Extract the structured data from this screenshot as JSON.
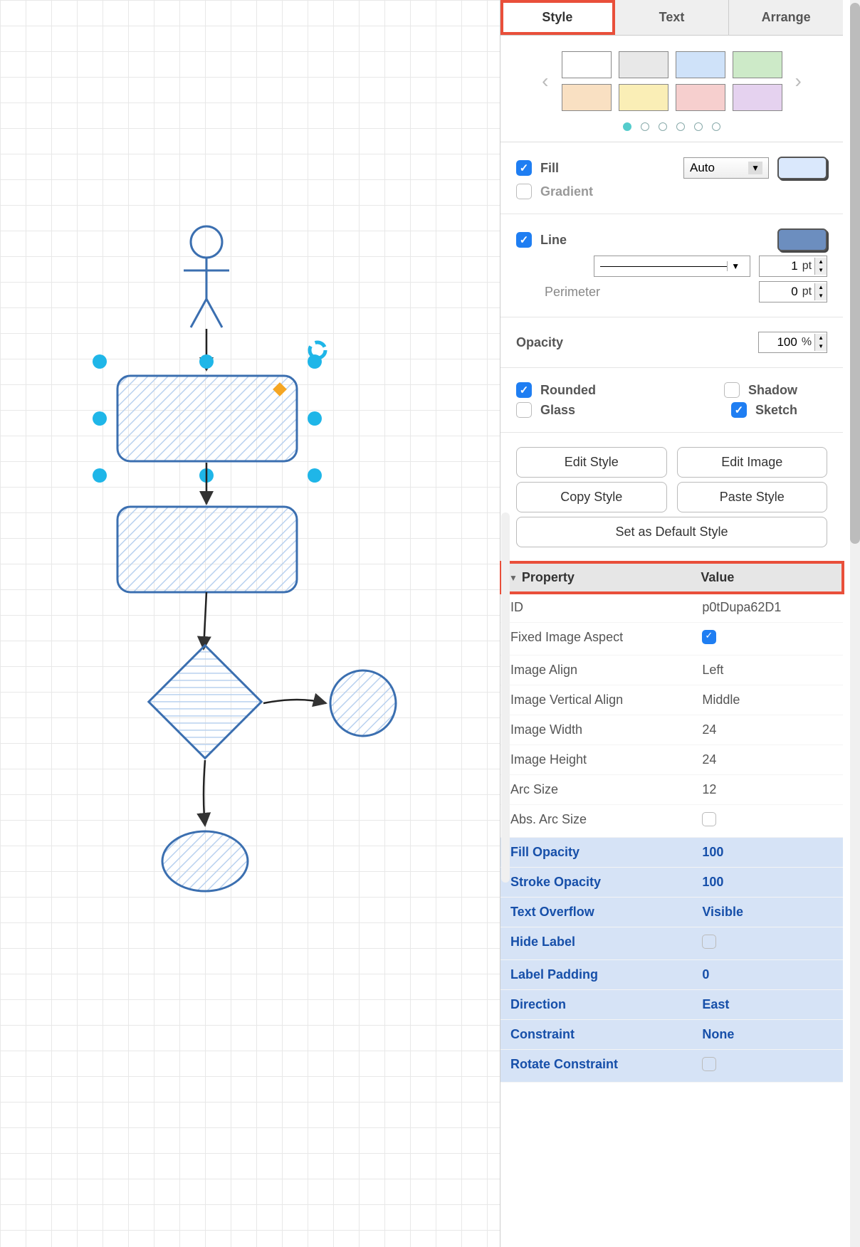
{
  "tabs": {
    "style": "Style",
    "text": "Text",
    "arrange": "Arrange"
  },
  "palette": {
    "colors_row1": [
      "#ffffff",
      "#e8e8e8",
      "#cfe2f9",
      "#cdeac8"
    ],
    "colors_row2": [
      "#f9e0c2",
      "#faeeb6",
      "#f6cfce",
      "#e5d2ef"
    ]
  },
  "fill": {
    "label": "Fill",
    "checked": true,
    "mode": "Auto",
    "color": "#dae8fc"
  },
  "gradient": {
    "label": "Gradient",
    "checked": false
  },
  "line": {
    "label": "Line",
    "checked": true,
    "color": "#6c8ebf",
    "width_value": "1",
    "width_unit": "pt"
  },
  "perimeter": {
    "label": "Perimeter",
    "value": "0",
    "unit": "pt"
  },
  "opacity": {
    "label": "Opacity",
    "value": "100",
    "unit": "%"
  },
  "toggles": {
    "rounded": {
      "label": "Rounded",
      "checked": true
    },
    "shadow": {
      "label": "Shadow",
      "checked": false
    },
    "glass": {
      "label": "Glass",
      "checked": false
    },
    "sketch": {
      "label": "Sketch",
      "checked": true
    }
  },
  "buttons": {
    "edit_style": "Edit Style",
    "edit_image": "Edit Image",
    "copy_style": "Copy Style",
    "paste_style": "Paste Style",
    "set_default": "Set as Default Style"
  },
  "prop_header": {
    "property": "Property",
    "value": "Value"
  },
  "properties": [
    {
      "k": "ID",
      "v": "p0tDupa62D1",
      "hl": false,
      "chk": null
    },
    {
      "k": "Fixed Image Aspect",
      "v": "",
      "hl": false,
      "chk": true
    },
    {
      "k": "Image Align",
      "v": "Left",
      "hl": false,
      "chk": null
    },
    {
      "k": "Image Vertical Align",
      "v": "Middle",
      "hl": false,
      "chk": null
    },
    {
      "k": "Image Width",
      "v": "24",
      "hl": false,
      "chk": null
    },
    {
      "k": "Image Height",
      "v": "24",
      "hl": false,
      "chk": null
    },
    {
      "k": "Arc Size",
      "v": "12",
      "hl": false,
      "chk": null
    },
    {
      "k": "Abs. Arc Size",
      "v": "",
      "hl": false,
      "chk": false
    },
    {
      "k": "Fill Opacity",
      "v": "100",
      "hl": true,
      "chk": null
    },
    {
      "k": "Stroke Opacity",
      "v": "100",
      "hl": true,
      "chk": null
    },
    {
      "k": "Text Overflow",
      "v": "Visible",
      "hl": true,
      "chk": null
    },
    {
      "k": "Hide Label",
      "v": "",
      "hl": true,
      "chk": false
    },
    {
      "k": "Label Padding",
      "v": "0",
      "hl": true,
      "chk": null
    },
    {
      "k": "Direction",
      "v": "East",
      "hl": true,
      "chk": null
    },
    {
      "k": "Constraint",
      "v": "None",
      "hl": true,
      "chk": null
    },
    {
      "k": "Rotate Constraint",
      "v": "",
      "hl": true,
      "chk": false
    }
  ]
}
